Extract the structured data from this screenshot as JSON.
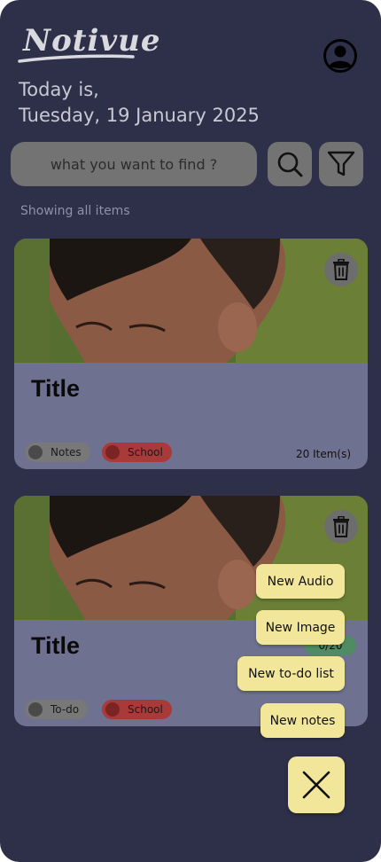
{
  "app": {
    "logo_text": "Notivue"
  },
  "header": {
    "date_line1": "Today is,",
    "date_line2": "Tuesday, 19 January 2025"
  },
  "search": {
    "placeholder": "what you want to find ?"
  },
  "status": {
    "text": "Showing all items"
  },
  "cards": [
    {
      "title": "Title",
      "tags": [
        {
          "label": "Notes",
          "color": "#787878"
        },
        {
          "label": "School",
          "color": "#a83a3a"
        }
      ],
      "count": "20 Item(s)"
    },
    {
      "title": "Title",
      "tags": [
        {
          "label": "To-do",
          "color": "#787878"
        },
        {
          "label": "School",
          "color": "#a83a3a"
        }
      ],
      "progress": "0/20",
      "count_partial": "0"
    }
  ],
  "fab_menu": {
    "new_audio": "New Audio",
    "new_image": "New Image",
    "new_todo": "New to-do list",
    "new_notes": "New notes"
  },
  "icons": {
    "profile": "account-circle-icon",
    "search": "search-icon",
    "filter": "filter-icon",
    "trash": "trash-icon",
    "close": "close-icon"
  },
  "colors": {
    "background": "#2e3049",
    "card": "#6e7190",
    "accent_yellow": "#f2e69a",
    "tag_red": "#a83a3a",
    "progress_green": "#4f8c63"
  }
}
